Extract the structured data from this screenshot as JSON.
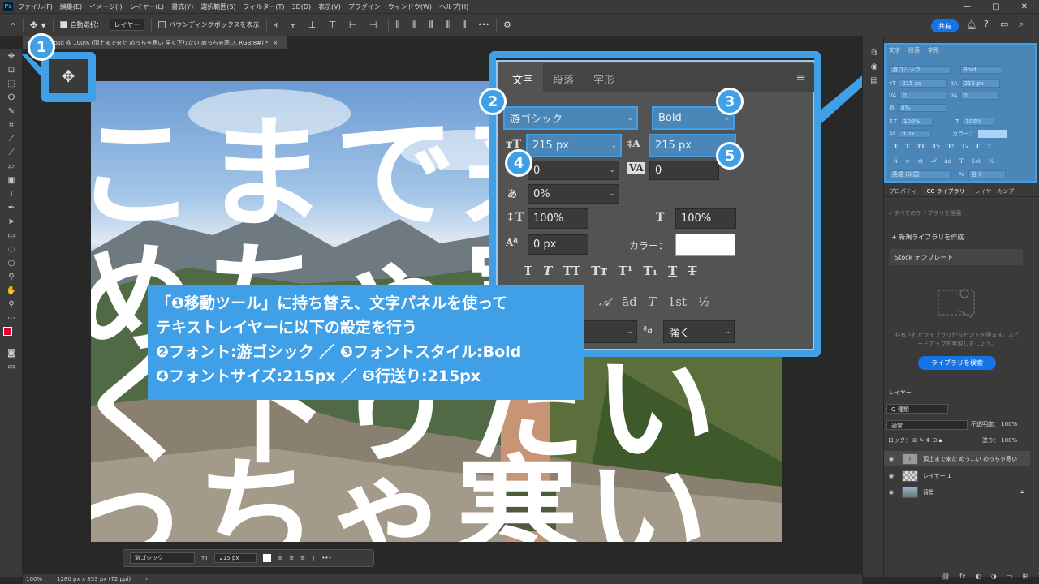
{
  "app": {
    "logo": "Ps"
  },
  "menu": [
    "ファイル(F)",
    "編集(E)",
    "イメージ(I)",
    "レイヤー(L)",
    "書式(Y)",
    "選択範囲(S)",
    "フィルター(T)",
    "3D(D)",
    "表示(V)",
    "プラグイン",
    "ウィンドウ(W)",
    "ヘルプ(H)"
  ],
  "window_controls": {
    "min": "—",
    "max": "▢",
    "close": "✕"
  },
  "options": {
    "auto_select_label": "自動選択：",
    "auto_select_target": "レイヤー",
    "bbox_label": "バウンディングボックスを表示",
    "more": "•••",
    "share": "共有"
  },
  "doc_tab": {
    "title": "実践.psd @ 100% (頂上まで来た めっちゃ寒い 早く下りたい めっちゃ寒い, RGB/8#) *",
    "close": "×"
  },
  "canvas_text": {
    "line1": "こまで来",
    "line2": "めちゃ寒",
    "line3": "く下りたい",
    "line4": "っちゃ寒い"
  },
  "char_panel": {
    "tabs": [
      "文字",
      "段落",
      "字形"
    ],
    "menu_icon": "≡",
    "font_family": "游ゴシック",
    "font_style": "Bold",
    "font_size": "215 px",
    "leading": "215 px",
    "kerning": "0",
    "tracking": "0",
    "tsume": "0%",
    "vscale": "100%",
    "hscale": "100%",
    "baseline": "0 px",
    "color_label": "カラー：",
    "color": "#ffffff",
    "style_buttons": [
      "T",
      "T",
      "TT",
      "Tт",
      "T¹",
      "T₁",
      "T",
      "T"
    ],
    "opentype_glyphs": [
      "𝒜",
      "ād",
      "T",
      "1st",
      "½"
    ],
    "aa_label": "ªa",
    "aa_value": "強く"
  },
  "instructions": {
    "line1": "「❶移動ツール」に持ち替え、文字パネルを使って",
    "line2": "テキストレイヤーに以下の設定を行う",
    "line3": "❷フォント:游ゴシック ／ ❸フォントスタイル:Bold",
    "line4": "❹フォントサイズ:215px ／ ❺行送り:215px"
  },
  "badges": [
    "1",
    "2",
    "3",
    "4",
    "5"
  ],
  "mini_char": {
    "tabs": [
      "文字",
      "段落",
      "字形"
    ],
    "font": "游ゴシック",
    "style": "Bold",
    "size": "215 px",
    "leading": "215 px",
    "kerning": "0",
    "tracking": "0",
    "tsume": "0%",
    "vscale": "100%",
    "hscale": "100%",
    "baseline": "0 px",
    "color_label": "カラー：",
    "lang": "英語 (米国)",
    "aa": "強く"
  },
  "library": {
    "tabs": [
      "プロパティ",
      "CC ライブラリ",
      "レイヤーカンプ"
    ],
    "search_placeholder": "すべてのライブラリを検索",
    "new_label": "+ 新規ライブラリを作成",
    "stock_label": "Stock テンプレート",
    "desc": "共有されたライブラリからヒントを得ます。スピードアップを実現しましょう。",
    "button": "ライブラリを検索"
  },
  "layers": {
    "header": "レイヤー",
    "kind": "Q 種類",
    "blend": "通常",
    "opacity_label": "不透明度：",
    "opacity": "100%",
    "lock_label": "ロック：",
    "fill_label": "塗り：",
    "fill": "100%",
    "items": [
      {
        "name": "頂上まで来た めっ...い めっちゃ寒い",
        "thumb": "T"
      },
      {
        "name": "レイヤー 1",
        "thumb": ""
      },
      {
        "name": "背景",
        "thumb": ""
      }
    ]
  },
  "context_bar": {
    "font": "游ゴシック",
    "size": "215 px",
    "more": "•••"
  },
  "status": {
    "zoom": "100%",
    "size": "1280 px x 853 px (72 ppi)",
    "arrow": "›"
  }
}
